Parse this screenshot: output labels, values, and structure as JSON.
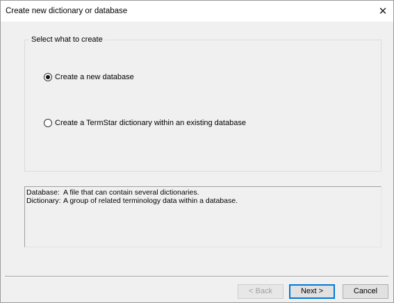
{
  "window": {
    "title": "Create new dictionary or database",
    "close_icon": "close-icon",
    "close_glyph": "✕"
  },
  "groupbox": {
    "legend": "Select what to create",
    "options": [
      {
        "label": "Create a new database",
        "selected": true
      },
      {
        "label": "Create a TermStar dictionary within an existing database",
        "selected": false
      }
    ]
  },
  "info": {
    "rows": [
      {
        "term": "Database:",
        "definition": "A file that can contain several dictionaries."
      },
      {
        "term": "Dictionary:",
        "definition": "A group of related terminology data within a database."
      }
    ]
  },
  "buttons": {
    "back": "< Back",
    "next": "Next >",
    "cancel": "Cancel"
  },
  "colors": {
    "dialog_bg": "#f0f0f0",
    "titlebar_bg": "#ffffff",
    "default_button_border": "#0078d7"
  }
}
